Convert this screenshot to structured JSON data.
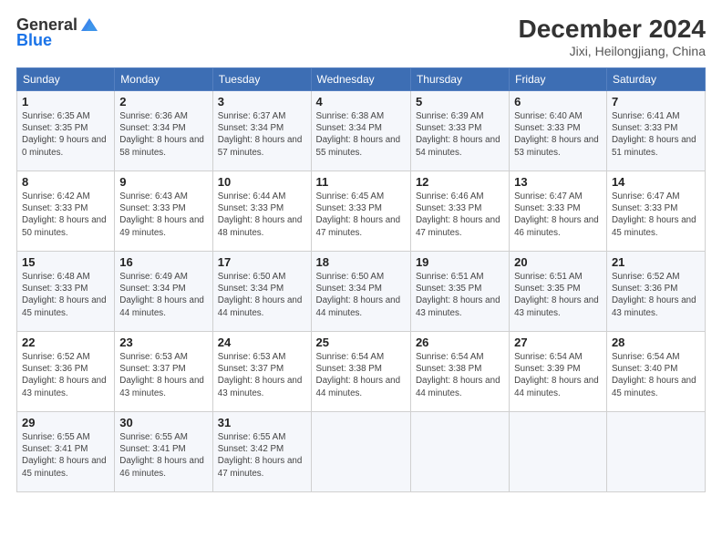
{
  "header": {
    "logo_general": "General",
    "logo_blue": "Blue",
    "month": "December 2024",
    "location": "Jixi, Heilongjiang, China"
  },
  "days_of_week": [
    "Sunday",
    "Monday",
    "Tuesday",
    "Wednesday",
    "Thursday",
    "Friday",
    "Saturday"
  ],
  "weeks": [
    [
      {
        "day": "1",
        "sunrise": "6:35 AM",
        "sunset": "3:35 PM",
        "daylight": "9 hours and 0 minutes."
      },
      {
        "day": "2",
        "sunrise": "6:36 AM",
        "sunset": "3:34 PM",
        "daylight": "8 hours and 58 minutes."
      },
      {
        "day": "3",
        "sunrise": "6:37 AM",
        "sunset": "3:34 PM",
        "daylight": "8 hours and 57 minutes."
      },
      {
        "day": "4",
        "sunrise": "6:38 AM",
        "sunset": "3:34 PM",
        "daylight": "8 hours and 55 minutes."
      },
      {
        "day": "5",
        "sunrise": "6:39 AM",
        "sunset": "3:33 PM",
        "daylight": "8 hours and 54 minutes."
      },
      {
        "day": "6",
        "sunrise": "6:40 AM",
        "sunset": "3:33 PM",
        "daylight": "8 hours and 53 minutes."
      },
      {
        "day": "7",
        "sunrise": "6:41 AM",
        "sunset": "3:33 PM",
        "daylight": "8 hours and 51 minutes."
      }
    ],
    [
      {
        "day": "8",
        "sunrise": "6:42 AM",
        "sunset": "3:33 PM",
        "daylight": "8 hours and 50 minutes."
      },
      {
        "day": "9",
        "sunrise": "6:43 AM",
        "sunset": "3:33 PM",
        "daylight": "8 hours and 49 minutes."
      },
      {
        "day": "10",
        "sunrise": "6:44 AM",
        "sunset": "3:33 PM",
        "daylight": "8 hours and 48 minutes."
      },
      {
        "day": "11",
        "sunrise": "6:45 AM",
        "sunset": "3:33 PM",
        "daylight": "8 hours and 47 minutes."
      },
      {
        "day": "12",
        "sunrise": "6:46 AM",
        "sunset": "3:33 PM",
        "daylight": "8 hours and 47 minutes."
      },
      {
        "day": "13",
        "sunrise": "6:47 AM",
        "sunset": "3:33 PM",
        "daylight": "8 hours and 46 minutes."
      },
      {
        "day": "14",
        "sunrise": "6:47 AM",
        "sunset": "3:33 PM",
        "daylight": "8 hours and 45 minutes."
      }
    ],
    [
      {
        "day": "15",
        "sunrise": "6:48 AM",
        "sunset": "3:33 PM",
        "daylight": "8 hours and 45 minutes."
      },
      {
        "day": "16",
        "sunrise": "6:49 AM",
        "sunset": "3:34 PM",
        "daylight": "8 hours and 44 minutes."
      },
      {
        "day": "17",
        "sunrise": "6:50 AM",
        "sunset": "3:34 PM",
        "daylight": "8 hours and 44 minutes."
      },
      {
        "day": "18",
        "sunrise": "6:50 AM",
        "sunset": "3:34 PM",
        "daylight": "8 hours and 44 minutes."
      },
      {
        "day": "19",
        "sunrise": "6:51 AM",
        "sunset": "3:35 PM",
        "daylight": "8 hours and 43 minutes."
      },
      {
        "day": "20",
        "sunrise": "6:51 AM",
        "sunset": "3:35 PM",
        "daylight": "8 hours and 43 minutes."
      },
      {
        "day": "21",
        "sunrise": "6:52 AM",
        "sunset": "3:36 PM",
        "daylight": "8 hours and 43 minutes."
      }
    ],
    [
      {
        "day": "22",
        "sunrise": "6:52 AM",
        "sunset": "3:36 PM",
        "daylight": "8 hours and 43 minutes."
      },
      {
        "day": "23",
        "sunrise": "6:53 AM",
        "sunset": "3:37 PM",
        "daylight": "8 hours and 43 minutes."
      },
      {
        "day": "24",
        "sunrise": "6:53 AM",
        "sunset": "3:37 PM",
        "daylight": "8 hours and 43 minutes."
      },
      {
        "day": "25",
        "sunrise": "6:54 AM",
        "sunset": "3:38 PM",
        "daylight": "8 hours and 44 minutes."
      },
      {
        "day": "26",
        "sunrise": "6:54 AM",
        "sunset": "3:38 PM",
        "daylight": "8 hours and 44 minutes."
      },
      {
        "day": "27",
        "sunrise": "6:54 AM",
        "sunset": "3:39 PM",
        "daylight": "8 hours and 44 minutes."
      },
      {
        "day": "28",
        "sunrise": "6:54 AM",
        "sunset": "3:40 PM",
        "daylight": "8 hours and 45 minutes."
      }
    ],
    [
      {
        "day": "29",
        "sunrise": "6:55 AM",
        "sunset": "3:41 PM",
        "daylight": "8 hours and 45 minutes."
      },
      {
        "day": "30",
        "sunrise": "6:55 AM",
        "sunset": "3:41 PM",
        "daylight": "8 hours and 46 minutes."
      },
      {
        "day": "31",
        "sunrise": "6:55 AM",
        "sunset": "3:42 PM",
        "daylight": "8 hours and 47 minutes."
      },
      null,
      null,
      null,
      null
    ]
  ]
}
